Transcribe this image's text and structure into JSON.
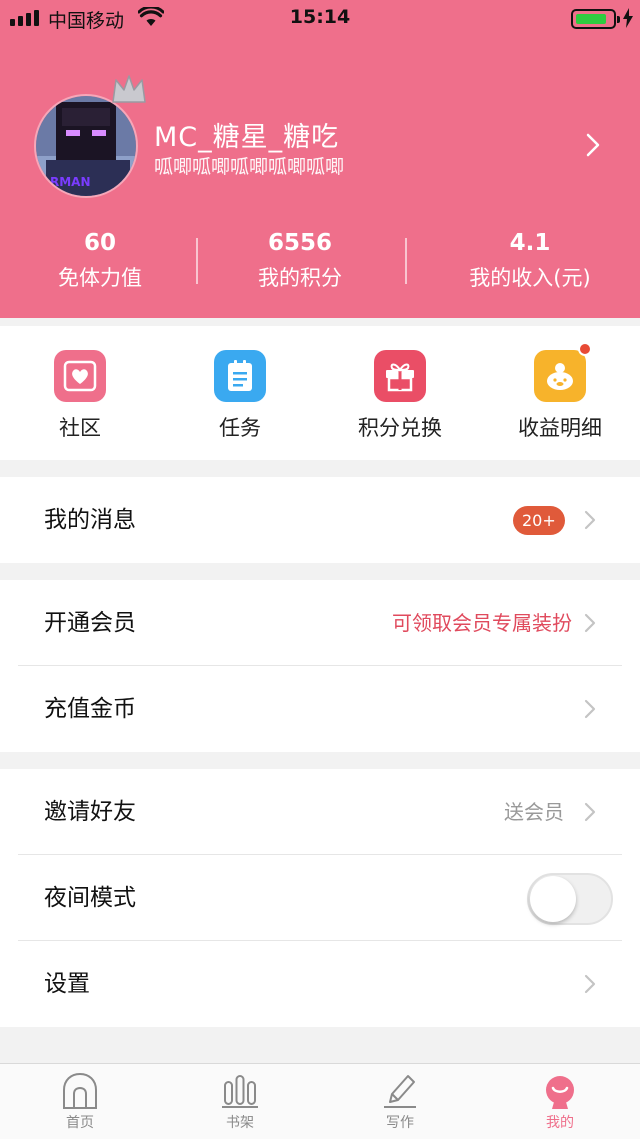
{
  "status_bar": {
    "carrier": "中国移动",
    "time": "15:14",
    "signal_icon": "signal-icon",
    "wifi_icon": "wifi-icon",
    "battery_icon": "battery-charging-icon"
  },
  "profile": {
    "nickname": "MC_糖星_糖吃",
    "bio": "呱唧呱唧呱唧呱唧呱唧",
    "avatar_text": "RMAN",
    "stats": [
      {
        "value": "60",
        "label": "免体力值"
      },
      {
        "value": "6556",
        "label": "我的积分"
      },
      {
        "value": "4.1",
        "label": "我的收入(元)"
      }
    ]
  },
  "quick_actions": [
    {
      "label": "社区",
      "icon": "community-heart-icon",
      "color": "#ef6f8b"
    },
    {
      "label": "任务",
      "icon": "task-list-icon",
      "color": "#3aa9f0"
    },
    {
      "label": "积分兑换",
      "icon": "gift-icon",
      "color": "#ea4e66"
    },
    {
      "label": "收益明细",
      "icon": "piggy-bank-icon",
      "color": "#f7b32b"
    }
  ],
  "menu": {
    "messages": {
      "label": "我的消息",
      "badge": "20+"
    },
    "vip": {
      "label": "开通会员",
      "hint": "可领取会员专属装扮"
    },
    "recharge": {
      "label": "充值金币"
    },
    "invite": {
      "label": "邀请好友",
      "hint": "送会员"
    },
    "night_mode": {
      "label": "夜间模式",
      "enabled": false
    },
    "settings": {
      "label": "设置"
    }
  },
  "tabbar": [
    {
      "label": "首页",
      "icon": "home-icon"
    },
    {
      "label": "书架",
      "icon": "bookshelf-icon"
    },
    {
      "label": "写作",
      "icon": "pen-icon"
    },
    {
      "label": "我的",
      "icon": "profile-icon",
      "active": true
    }
  ],
  "colors": {
    "brand": "#ef6f8b",
    "badge": "#e05a3a",
    "hint_red": "#e04a5d"
  }
}
